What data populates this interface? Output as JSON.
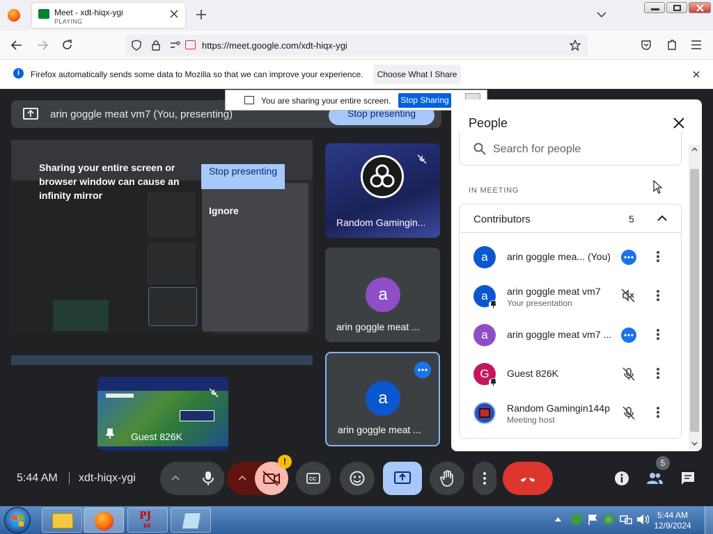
{
  "browser": {
    "tab_title": "Meet - xdt-hiqx-ygi",
    "tab_status": "PLAYING",
    "url": "https://meet.google.com/xdt-hiqx-ygi",
    "infobar_text": "Firefox automatically sends some data to Mozilla so that we can improve your experience.",
    "infobar_button": "Choose What I Share"
  },
  "share_notice": {
    "text": "You are sharing your entire screen.",
    "stop_label": "Stop Sharing"
  },
  "presenting": {
    "text": "arin goggle meat vm7 (You, presenting)",
    "stop_label": "Stop presenting"
  },
  "preview": {
    "warning": "Sharing your entire screen or browser window can cause an infinity mirror",
    "stop_label": "Stop presenting",
    "ignore_label": "Ignore"
  },
  "tiles": {
    "guest": "Guest 826K",
    "random": "Random Gamingin...",
    "arin1": "arin goggle meat ...",
    "arin1_initial": "a",
    "arin2": "arin goggle meat ...",
    "arin2_initial": "a"
  },
  "people": {
    "title": "People",
    "search_placeholder": "Search for people",
    "section": "IN MEETING",
    "group_label": "Contributors",
    "group_count": "5",
    "list": [
      {
        "initial": "a",
        "name": "arin goggle mea...",
        "tag": "(You)",
        "sub": "",
        "color": "#0b57d0"
      },
      {
        "initial": "a",
        "name": "arin goggle meat vm7",
        "tag": "",
        "sub": "Your presentation",
        "color": "#0b57d0"
      },
      {
        "initial": "a",
        "name": "arin goggle meat vm7 ...",
        "tag": "",
        "sub": "",
        "color": "#8e4ec6"
      },
      {
        "initial": "G",
        "name": "Guest 826K",
        "tag": "",
        "sub": "",
        "color": "#c2185b"
      },
      {
        "initial": "",
        "name": "Random Gamingin144p",
        "tag": "",
        "sub": "Meeting host",
        "color": "#3949ab"
      }
    ]
  },
  "bottom": {
    "time": "5:44 AM",
    "meeting_code": "xdt-hiqx-ygi",
    "people_badge": "5"
  },
  "taskbar": {
    "time": "5:44 AM",
    "date": "12/9/2024"
  }
}
